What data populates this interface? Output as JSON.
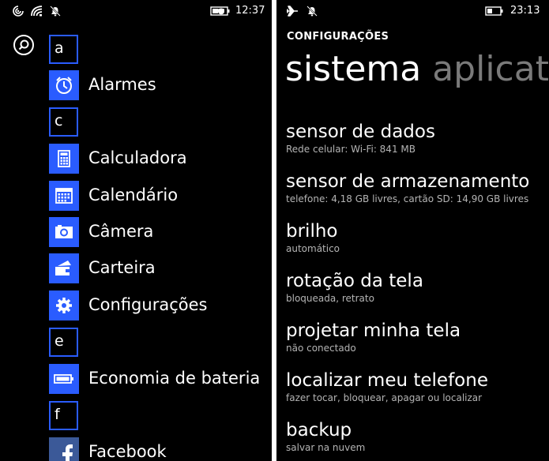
{
  "left": {
    "status": {
      "time": "12:37",
      "icons": [
        "nfc-icon",
        "wifi-icon",
        "quiet-hours-icon",
        "battery-saver-icon"
      ]
    },
    "letters": [
      "a",
      "c",
      "e",
      "f"
    ],
    "apps": [
      {
        "label": "Alarmes",
        "icon": "alarm-clock-icon"
      },
      {
        "label": "Calculadora",
        "icon": "calculator-icon"
      },
      {
        "label": "Calendário",
        "icon": "calendar-icon"
      },
      {
        "label": "Câmera",
        "icon": "camera-icon"
      },
      {
        "label": "Carteira",
        "icon": "wallet-icon"
      },
      {
        "label": "Configurações",
        "icon": "gear-icon"
      },
      {
        "label": "Economia de bateria",
        "icon": "battery-icon"
      },
      {
        "label": "Facebook",
        "icon": "facebook-icon"
      }
    ],
    "accent_color": "#2a5cff"
  },
  "right": {
    "status": {
      "time": "23:13",
      "icons": [
        "airplane-icon",
        "quiet-hours-icon",
        "battery-icon"
      ]
    },
    "page_title": "CONFIGURAÇÕES",
    "pivot": {
      "active": "sistema",
      "next": "aplicat"
    },
    "settings": [
      {
        "title": "sensor de dados",
        "subtitle": "Rede celular:  Wi-Fi: 841 MB"
      },
      {
        "title": "sensor de armazenamento",
        "subtitle": "telefone: 4,18 GB livres, cartão SD: 14,90 GB livres"
      },
      {
        "title": "brilho",
        "subtitle": "automático"
      },
      {
        "title": "rotação da tela",
        "subtitle": "bloqueada, retrato"
      },
      {
        "title": "projetar minha tela",
        "subtitle": "não conectado"
      },
      {
        "title": "localizar meu telefone",
        "subtitle": "fazer tocar, bloquear, apagar ou localizar"
      },
      {
        "title": "backup",
        "subtitle": "salvar na nuvem"
      }
    ]
  }
}
